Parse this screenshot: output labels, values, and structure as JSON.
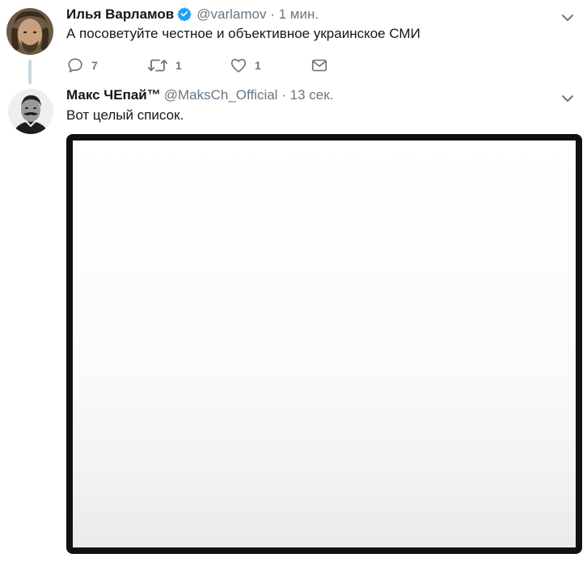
{
  "tweets": [
    {
      "fullname": "Илья Варламов",
      "verified": true,
      "username": "@varlamov",
      "separator": "·",
      "time": "1 мин.",
      "text": "А посоветуйте честное и объективное украинское СМИ",
      "actions": {
        "reply_count": "7",
        "retweet_count": "1",
        "like_count": "1"
      }
    },
    {
      "fullname": "Макс ЧЕпай™",
      "username": "@MaksCh_Official",
      "separator": "·",
      "time": "13 сек.",
      "text": "Вот целый список."
    }
  ],
  "colors": {
    "verified_badge": "#1da1f2",
    "secondary_text": "#657786",
    "primary_text": "#14171a",
    "thread_line": "#ccd6dd",
    "media_border": "#111111"
  },
  "icons": {
    "reply": "reply-icon",
    "retweet": "retweet-icon",
    "like": "heart-icon",
    "dm": "envelope-icon",
    "menu": "chevron-down-icon",
    "verified": "verified-badge-icon"
  }
}
